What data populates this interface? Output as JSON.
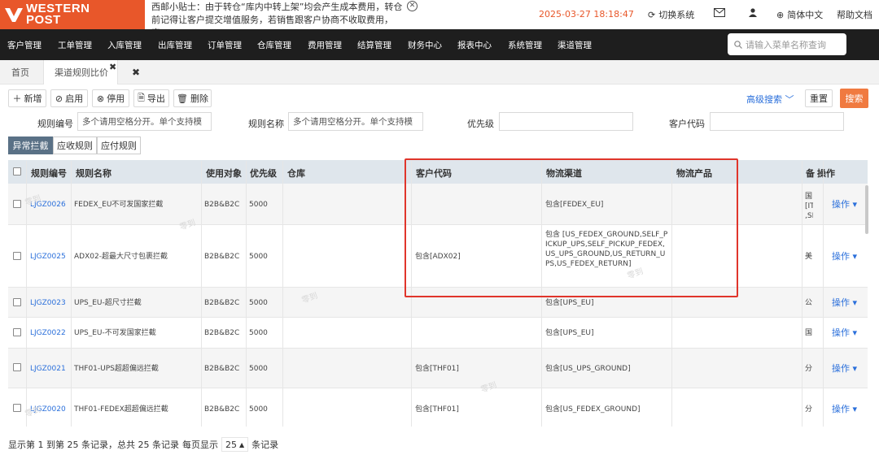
{
  "header": {
    "brand_line1": "WESTERN",
    "brand_line2": "POST",
    "tip_line1": "西邮小贴士：由于转仓“库内中转上架”均会产生成本费用，转仓",
    "tip_line2": "前记得让客户提交增值服务，若销售跟客户协商不收取费用，客...",
    "datetime": "2025-03-27 18:18:47",
    "switch_system": "切换系统",
    "language": "简体中文",
    "help": "帮助文档",
    "icons": [
      "refresh-icon",
      "mail-icon",
      "user-icon",
      "globe-icon"
    ],
    "brand_color": "#e8572a"
  },
  "nav": {
    "items": [
      "客户管理",
      "工单管理",
      "入库管理",
      "出库管理",
      "订单管理",
      "仓库管理",
      "费用管理",
      "结算管理",
      "财务中心",
      "报表中心",
      "系统管理",
      "渠道管理"
    ],
    "search_placeholder": "请输入菜单名称查询"
  },
  "tabs": {
    "home": "首页",
    "active": "渠道规则比价"
  },
  "toolbar": {
    "add": "新增",
    "enable": "启用",
    "disable": "停用",
    "export": "导出",
    "delete": "删除",
    "advanced_search": "高级搜索",
    "reset": "重置",
    "search": "搜索"
  },
  "filters": {
    "rule_code_label": "规则编号",
    "rule_code_placeholder": "多个请用空格分开。单个支持模",
    "rule_name_label": "规则名称",
    "rule_name_placeholder": "多个请用空格分开。单个支持模",
    "priority_label": "优先级",
    "customer_code_label": "客户代码"
  },
  "subtabs": [
    "异常拦截",
    "应收规则",
    "应付规则"
  ],
  "table": {
    "columns": [
      "规则编号",
      "规则名称",
      "使用对象",
      "优先级",
      "仓库",
      "客户代码",
      "物流渠道",
      "物流产品",
      "备",
      "操作"
    ],
    "rows": [
      {
        "code": "LJGZ0026",
        "name": "FEDEX_EU不可发国家拦截",
        "target": "B2B&B2C",
        "priority": "5000",
        "warehouse": "",
        "customer": "",
        "channel": "包含[FEDEX_EU]",
        "product": "",
        "remark": "国 [IT ,SI",
        "op": "操作"
      },
      {
        "code": "LJGZ0025",
        "name": "ADX02-超最大尺寸包裹拦截",
        "target": "B2B&B2C",
        "priority": "5000",
        "warehouse": "",
        "customer": "包含[ADX02]",
        "channel": "包含 [US_FEDEX_GROUND,SELF_PICKUP_UPS,SELF_PICKUP_FEDEX,US_UPS_GROUND,US_RETURN_UPS,US_FEDEX_RETURN]",
        "product": "",
        "remark": "美",
        "op": "操作"
      },
      {
        "code": "LJGZ0023",
        "name": "UPS_EU-超尺寸拦截",
        "target": "B2B&B2C",
        "priority": "5000",
        "warehouse": "",
        "customer": "",
        "channel": "包含[UPS_EU]",
        "product": "",
        "remark": "公",
        "op": "操作"
      },
      {
        "code": "LJGZ0022",
        "name": "UPS_EU-不可发国家拦截",
        "target": "B2B&B2C",
        "priority": "5000",
        "warehouse": "",
        "customer": "",
        "channel": "包含[UPS_EU]",
        "product": "",
        "remark": "国",
        "op": "操作"
      },
      {
        "code": "LJGZ0021",
        "name": "THF01-UPS超超偏远拦截",
        "target": "B2B&B2C",
        "priority": "5000",
        "warehouse": "",
        "customer": "包含[THF01]",
        "channel": "包含[US_UPS_GROUND]",
        "product": "",
        "remark": "分",
        "op": "操作"
      },
      {
        "code": "LJGZ0020",
        "name": "THF01-FEDEX超超偏远拦截",
        "target": "B2B&B2C",
        "priority": "5000",
        "warehouse": "",
        "customer": "包含[THF01]",
        "channel": "包含[US_FEDEX_GROUND]",
        "product": "",
        "remark": "分",
        "op": "操作"
      }
    ],
    "watermark": "零到"
  },
  "footer": {
    "summary": "显示第 1 到第 25 条记录，总共 25 条记录",
    "per_page_label": "每页显示",
    "page_size": "25",
    "records_suffix": "条记录"
  }
}
